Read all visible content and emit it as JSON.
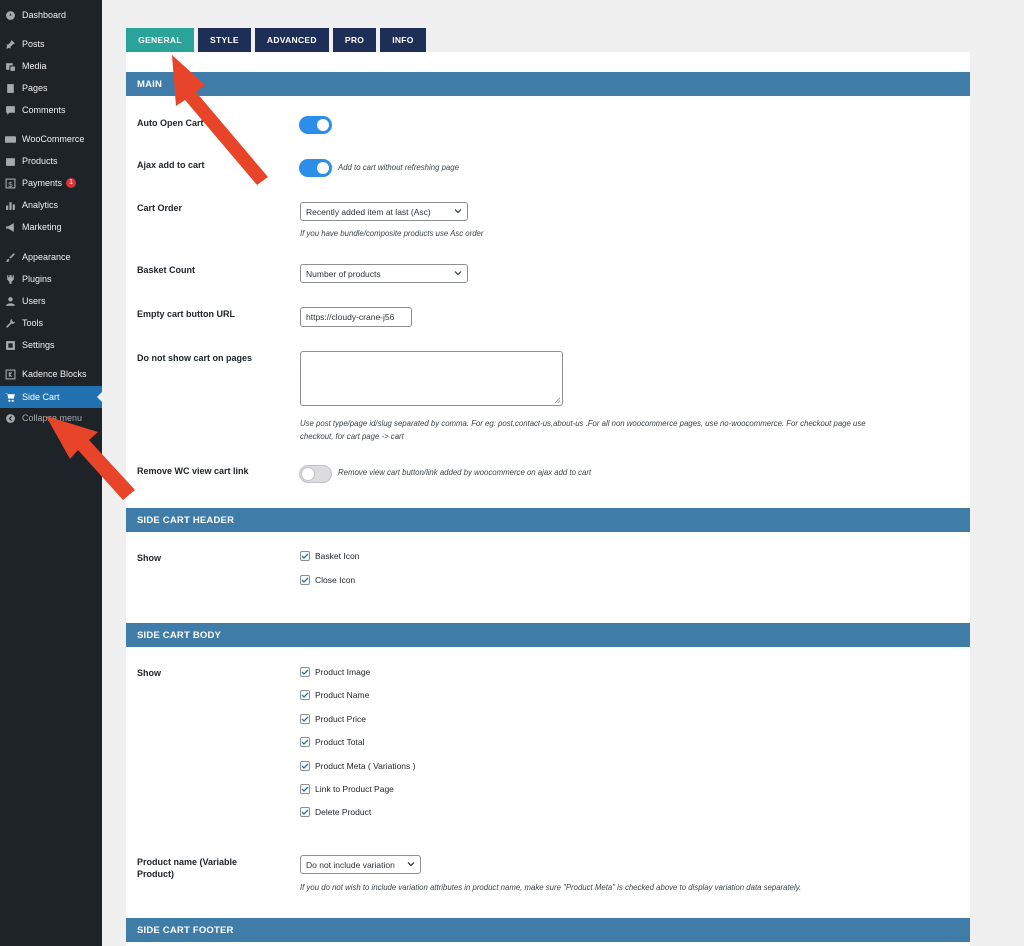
{
  "sidebar": {
    "items": [
      {
        "label": "Dashboard",
        "icon": "dashboard-icon"
      },
      {
        "label": "Posts",
        "icon": "pin-icon"
      },
      {
        "label": "Media",
        "icon": "media-icon"
      },
      {
        "label": "Pages",
        "icon": "pages-icon"
      },
      {
        "label": "Comments",
        "icon": "comment-icon"
      },
      {
        "label": "WooCommerce",
        "icon": "woocommerce-icon"
      },
      {
        "label": "Products",
        "icon": "products-icon"
      },
      {
        "label": "Payments",
        "icon": "payments-icon",
        "badge": "1"
      },
      {
        "label": "Analytics",
        "icon": "analytics-icon"
      },
      {
        "label": "Marketing",
        "icon": "megaphone-icon"
      },
      {
        "label": "Appearance",
        "icon": "brush-icon"
      },
      {
        "label": "Plugins",
        "icon": "plugin-icon"
      },
      {
        "label": "Users",
        "icon": "users-icon"
      },
      {
        "label": "Tools",
        "icon": "wrench-icon"
      },
      {
        "label": "Settings",
        "icon": "settings-icon"
      },
      {
        "label": "Kadence Blocks",
        "icon": "kadence-icon"
      },
      {
        "label": "Side Cart",
        "icon": "cart-icon"
      },
      {
        "label": "Collapse menu",
        "icon": "collapse-icon"
      }
    ]
  },
  "tabs": [
    "GENERAL",
    "STYLE",
    "ADVANCED",
    "PRO",
    "INFO"
  ],
  "main": {
    "header": "MAIN",
    "auto_open_cart": {
      "label": "Auto Open Cart",
      "value": "on"
    },
    "ajax_add_to_cart": {
      "label": "Ajax add to cart",
      "value": "on",
      "hint": "Add to cart without refreshing page"
    },
    "cart_order": {
      "label": "Cart Order",
      "value": "Recently added item at last (Asc)",
      "hint": "If you have bundle/composite products use Asc order"
    },
    "basket_count": {
      "label": "Basket Count",
      "value": "Number of products"
    },
    "empty_cart_url": {
      "label": "Empty cart button URL",
      "value": "https://cloudy-crane-j56"
    },
    "hide_on_pages": {
      "label": "Do not show cart on pages",
      "value": "",
      "hint_line1": "Use post type/page id/slug separated by comma. For eg: post,contact-us,about-us .For all non woocommerce pages, use no-woocommerce. For checkout page use",
      "hint_line2": "checkout, for cart page -> cart"
    },
    "remove_view_cart": {
      "label": "Remove WC view cart link",
      "value": "off",
      "hint": "Remove view cart button/link added by woocommerce on ajax add to cart"
    }
  },
  "header_section": {
    "header": "SIDE CART HEADER",
    "show_label": "Show",
    "options": [
      {
        "label": "Basket Icon",
        "checked": true
      },
      {
        "label": "Close Icon",
        "checked": true
      }
    ]
  },
  "body_section": {
    "header": "SIDE CART BODY",
    "show_label": "Show",
    "options": [
      {
        "label": "Product Image",
        "checked": true
      },
      {
        "label": "Product Name",
        "checked": true
      },
      {
        "label": "Product Price",
        "checked": true
      },
      {
        "label": "Product Total",
        "checked": true
      },
      {
        "label": "Product Meta ( Variations )",
        "checked": true
      },
      {
        "label": "Link to Product Page",
        "checked": true
      },
      {
        "label": "Delete Product",
        "checked": true
      }
    ],
    "product_name_variable": {
      "label_line1": "Product name (Variable",
      "label_line2": "Product)",
      "value": "Do not include variation",
      "hint": "If you do not wish to include variation attributes in product name, make sure \"Product Meta\" is checked above to display variation data separately."
    }
  },
  "footer_section": {
    "header": "SIDE CART FOOTER"
  },
  "colors": {
    "accent_tab": "#2aa39a",
    "tab_bg": "#1d2e57",
    "section_header": "#3f7ca8",
    "toggle_on": "#2b8ee8",
    "annotation_arrow": "#e8442a"
  }
}
